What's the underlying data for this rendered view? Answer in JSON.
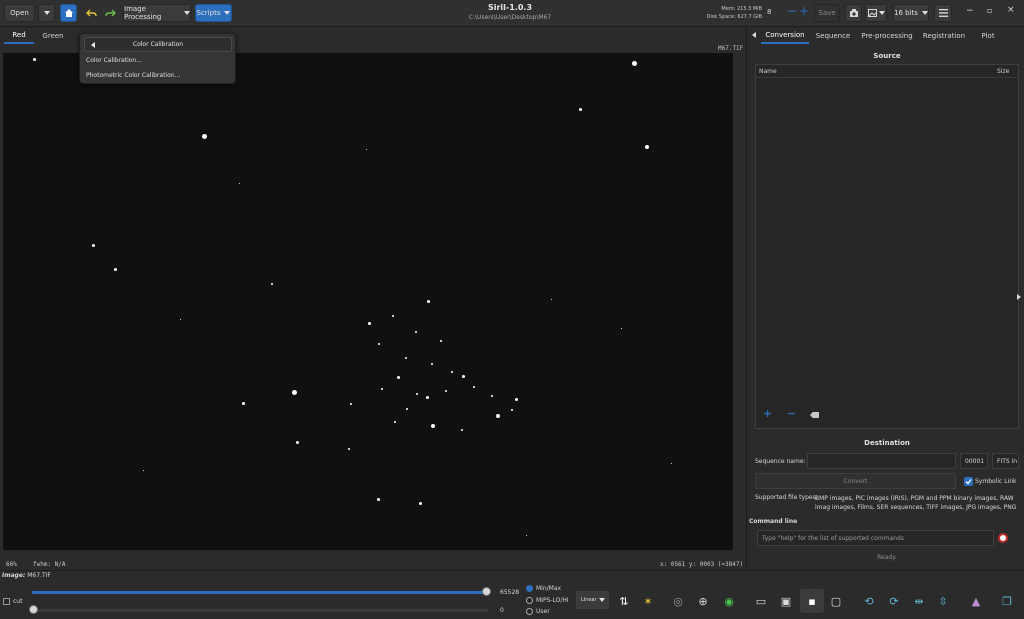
{
  "header": {
    "open_label": "Open",
    "image_processing_label": "Image Processing",
    "scripts_label": "Scripts",
    "app_title": "Siril-1.0.3",
    "file_path": "C:\\Users\\User\\Desktop\\M67",
    "mem_label": "Mem: 215.3 MiB",
    "disk_label": "Disk Space: 627.7 GiB",
    "thread_count": "8",
    "save_label": "Save",
    "bits_label": "16 bits"
  },
  "channel_tabs": [
    "Red",
    "Green"
  ],
  "image_name_top": "M67.TIF",
  "menu": {
    "header": "Color Calibration",
    "items": [
      "Color Calibration...",
      "Photometric Color Calibration..."
    ]
  },
  "status": {
    "zoom": "66%",
    "fwhm": "fwhm: N/A",
    "coords": "x: 0561  y: 0003  (=3847)"
  },
  "right_panel": {
    "tabs": [
      "Conversion",
      "Sequence",
      "Pre-processing",
      "Registration",
      "Plot"
    ],
    "source_title": "Source",
    "col_name": "Name",
    "col_size": "Size",
    "destination_title": "Destination",
    "sequence_name_label": "Sequence name:",
    "start_index": "00001",
    "format_value": "FITS in",
    "convert_label": "Convert",
    "symbolic_link_label": "Symbolic Link",
    "supported_types_label": "Supported file types:",
    "supported_types_text": "BMP images, PIC images (IRIS), PGM and PPM binary images, RAW imag images, Films, SER sequences, TIFF images, JPG images, PNG images, HE",
    "command_line_title": "Command line",
    "command_placeholder": "Type \"help\" for the list of supported commands",
    "ready_text": "Ready."
  },
  "bottom": {
    "image_label": "Image:",
    "image_name": "M67.TIF",
    "cut_label": "cut",
    "max_value": "65528",
    "min_value": "0",
    "radio_options": [
      "Min/Max",
      "MIPS-LO/HI",
      "User"
    ],
    "stretch_value": "Linear"
  },
  "colors": {
    "accent": "#2c6fbf",
    "background": "#2b2b2b",
    "canvas": "#101010"
  }
}
